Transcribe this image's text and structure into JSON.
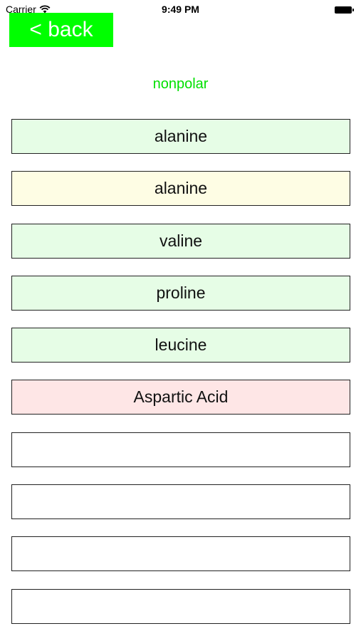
{
  "status_bar": {
    "carrier": "Carrier",
    "time": "9:49 PM",
    "wifi_icon": "wifi-icon",
    "battery_icon": "battery-icon"
  },
  "nav": {
    "back_label": "< back",
    "back_color": "#00ff00"
  },
  "category": {
    "title": "nonpolar",
    "color": "#00e000"
  },
  "items": [
    {
      "label": "alanine",
      "color": "#e6fde6"
    },
    {
      "label": "alanine",
      "color": "#fefde4"
    },
    {
      "label": "valine",
      "color": "#e6fde6"
    },
    {
      "label": "proline",
      "color": "#e6fde6"
    },
    {
      "label": "leucine",
      "color": "#e6fde6"
    },
    {
      "label": "Aspartic Acid",
      "color": "#fee6e6"
    },
    {
      "label": "",
      "color": "#ffffff"
    },
    {
      "label": "",
      "color": "#ffffff"
    },
    {
      "label": "",
      "color": "#ffffff"
    },
    {
      "label": "",
      "color": "#ffffff"
    }
  ]
}
